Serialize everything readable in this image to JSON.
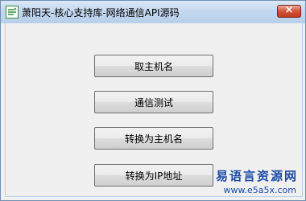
{
  "window": {
    "title": "萧阳天-核心支持库-网络通信API源码",
    "icon": "app-icon",
    "close_label": "×",
    "title_bar_color": "#c4d8ef",
    "close_button_color": "#c7442b"
  },
  "buttons": {
    "get_hostname": "取主机名",
    "comm_test": "通信测试",
    "to_hostname": "转换为主机名",
    "to_ip": "转换为IP地址"
  },
  "watermark": {
    "brand": "易语言资源网",
    "url": "www.e5a5x.com",
    "color": "#1b4aa8"
  }
}
